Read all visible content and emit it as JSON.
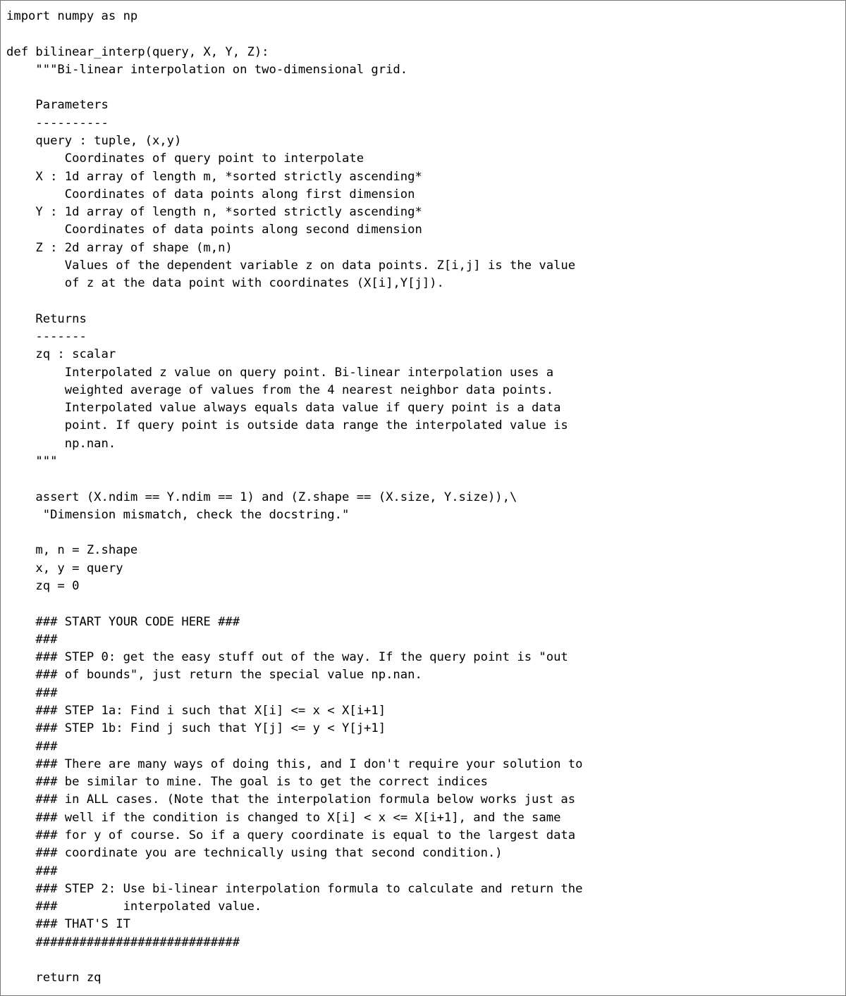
{
  "code": {
    "lines": [
      "import numpy as np",
      "",
      "def bilinear_interp(query, X, Y, Z):",
      "    \"\"\"Bi-linear interpolation on two-dimensional grid.",
      "",
      "    Parameters",
      "    ----------",
      "    query : tuple, (x,y)",
      "        Coordinates of query point to interpolate",
      "    X : 1d array of length m, *sorted strictly ascending*",
      "        Coordinates of data points along first dimension",
      "    Y : 1d array of length n, *sorted strictly ascending*",
      "        Coordinates of data points along second dimension",
      "    Z : 2d array of shape (m,n)",
      "        Values of the dependent variable z on data points. Z[i,j] is the value",
      "        of z at the data point with coordinates (X[i],Y[j]).",
      "",
      "    Returns",
      "    -------",
      "    zq : scalar",
      "        Interpolated z value on query point. Bi-linear interpolation uses a",
      "        weighted average of values from the 4 nearest neighbor data points.",
      "        Interpolated value always equals data value if query point is a data",
      "        point. If query point is outside data range the interpolated value is",
      "        np.nan.",
      "    \"\"\"",
      "",
      "    assert (X.ndim == Y.ndim == 1) and (Z.shape == (X.size, Y.size)),\\",
      "     \"Dimension mismatch, check the docstring.\"",
      "",
      "    m, n = Z.shape",
      "    x, y = query",
      "    zq = 0",
      "",
      "    ### START YOUR CODE HERE ###",
      "    ###",
      "    ### STEP 0: get the easy stuff out of the way. If the query point is \"out",
      "    ### of bounds\", just return the special value np.nan.",
      "    ###",
      "    ### STEP 1a: Find i such that X[i] <= x < X[i+1]",
      "    ### STEP 1b: Find j such that Y[j] <= y < Y[j+1]",
      "    ###",
      "    ### There are many ways of doing this, and I don't require your solution to",
      "    ### be similar to mine. The goal is to get the correct indices",
      "    ### in ALL cases. (Note that the interpolation formula below works just as",
      "    ### well if the condition is changed to X[i] < x <= X[i+1], and the same",
      "    ### for y of course. So if a query coordinate is equal to the largest data",
      "    ### coordinate you are technically using that second condition.)",
      "    ###",
      "    ### STEP 2: Use bi-linear interpolation formula to calculate and return the",
      "    ###         interpolated value.",
      "    ### THAT'S IT",
      "    ############################",
      "",
      "    return zq"
    ]
  }
}
